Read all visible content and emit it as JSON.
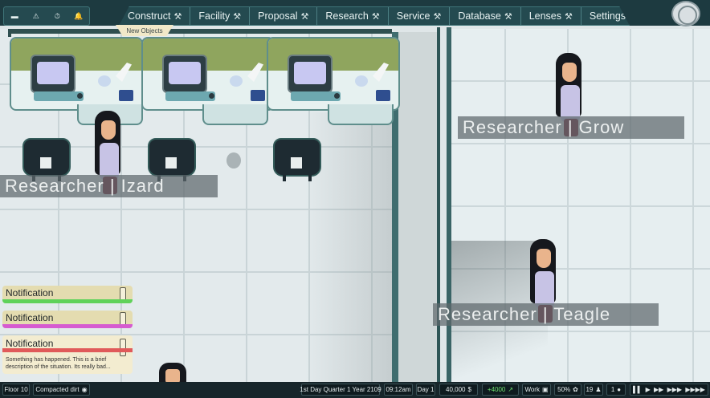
{
  "top_bar": {
    "quick_icons": [
      "▬",
      "⚠",
      "⏱",
      "🔔"
    ],
    "menu": [
      {
        "label": "Construct",
        "icon": "⚒"
      },
      {
        "label": "Facility",
        "icon": "⚒"
      },
      {
        "label": "Proposal",
        "icon": "⚒"
      },
      {
        "label": "Research",
        "icon": "⚒"
      },
      {
        "label": "Service",
        "icon": "⚒"
      },
      {
        "label": "Database",
        "icon": "⚒"
      },
      {
        "label": "Lenses",
        "icon": "⚒"
      },
      {
        "label": "Settings",
        "icon": "⚒"
      }
    ],
    "new_objects_tab": "New Objects"
  },
  "researchers": [
    {
      "label": "Researcher | Izard"
    },
    {
      "label": "Researcher | Grow"
    },
    {
      "label": "Researcher | Teagle"
    }
  ],
  "notifications": [
    {
      "title": "Notification",
      "bar_color": "#5fd25a"
    },
    {
      "title": "Notification",
      "bar_color": "#d65bd0"
    },
    {
      "title": "Notification",
      "bar_color": "#e05a5a",
      "message": "Something has happened.  This is a brief description of the situation. Its really bad..."
    }
  ],
  "bottom_bar": {
    "floor": "Floor 10",
    "tile": "Compacted dirt",
    "date": "1st Day Quarter 1 Year 2109",
    "time": "09:12am",
    "day": "Day 1",
    "money": "40,000",
    "money_symbol": "$",
    "income": "+4000",
    "mode": "Work",
    "percent": "50%",
    "staff_count": "19",
    "alert_count": "1",
    "speed_controls": [
      "▌▌",
      "▶",
      "▶▶",
      "▶▶▶",
      "▶▶▶▶"
    ]
  },
  "colors": {
    "topbar": "#1d3a40",
    "wall": "#3f6d6f",
    "floor": "#e3eaec",
    "bench_band": "#8fa55e"
  }
}
